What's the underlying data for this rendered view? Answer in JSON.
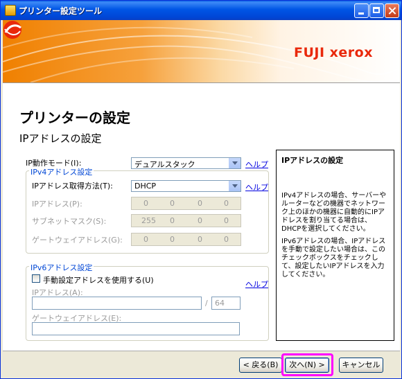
{
  "window": {
    "title": "プリンター設定ツール"
  },
  "banner": {
    "brand": "FUJI xerox"
  },
  "page": {
    "title": "プリンターの設定",
    "subtitle": "IPアドレスの設定"
  },
  "ip_mode": {
    "label": "IP動作モード(I):",
    "value": "デュアルスタック",
    "help": "ヘルプ"
  },
  "ipv4": {
    "group_title": "IPv4アドレス設定",
    "method_label": "IPアドレス取得方法(T):",
    "method_value": "DHCP",
    "help": "ヘルプ",
    "ip_label": "IPアドレス(P):",
    "ip_values": [
      "0",
      "0",
      "0",
      "0"
    ],
    "subnet_label": "サブネットマスク(S):",
    "subnet_values": [
      "255",
      "0",
      "0",
      "0"
    ],
    "gateway_label": "ゲートウェイアドレス(G):",
    "gateway_values": [
      "0",
      "0",
      "0",
      "0"
    ]
  },
  "ipv6": {
    "group_title": "IPv6アドレス設定",
    "manual_label": "手動設定アドレスを使用する(U)",
    "help": "ヘルプ",
    "ip_label": "IPアドレス(A):",
    "ip_value": "",
    "slash": "/",
    "prefix_value": "64",
    "gateway_label": "ゲートウェイアドレス(E):",
    "gateway_value": ""
  },
  "help_panel": {
    "title": "IPアドレスの設定",
    "paragraph1": "IPv4アドレスの場合、サーバーやルーターなどの機器でネットワーク上のほかの機器に自動的にIPアドレスを割り当てる場合は、DHCPを選択してください。",
    "paragraph2": "IPv6アドレスの場合、IPアドレスを手動で設定したい場合は、このチェックボックスをチェックして、設定したいIPアドレスを入力してください。"
  },
  "buttons": {
    "back": "< 戻る(B)",
    "next": "次へ(N) >",
    "cancel": "キャンセル"
  },
  "colors": {
    "highlight": "#ff00ff",
    "brand": "#e9280b",
    "group_title": "#0046d5"
  }
}
